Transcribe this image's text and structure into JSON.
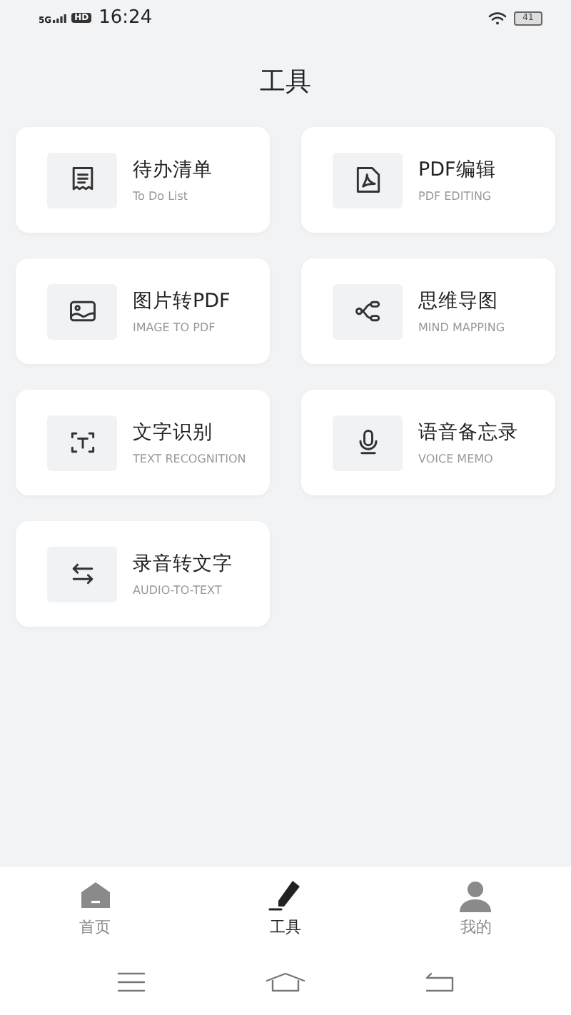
{
  "status_bar": {
    "network": "5G",
    "hd": "HD",
    "time": "16:24",
    "battery": "41"
  },
  "title": "工具",
  "tools": [
    {
      "kind": "list",
      "title": "待办清单",
      "subtitle": "To Do List"
    },
    {
      "kind": "pdf",
      "title": "PDF编辑",
      "subtitle": "PDF EDITING"
    },
    {
      "kind": "image",
      "title": "图片转PDF",
      "subtitle": "IMAGE TO PDF"
    },
    {
      "kind": "mindmap",
      "title": "思维导图",
      "subtitle": "MIND MAPPING"
    },
    {
      "kind": "textscan",
      "title": "文字识别",
      "subtitle": "TEXT RECOGNITION"
    },
    {
      "kind": "mic",
      "title": "语音备忘录",
      "subtitle": "VOICE MEMO"
    },
    {
      "kind": "swap",
      "title": "录音转文字",
      "subtitle": "AUDIO-TO-TEXT"
    }
  ],
  "tabs": [
    {
      "kind": "home",
      "label": "首页",
      "selected": false
    },
    {
      "kind": "tools",
      "label": "工具",
      "selected": true
    },
    {
      "kind": "profile",
      "label": "我的",
      "selected": false
    }
  ]
}
